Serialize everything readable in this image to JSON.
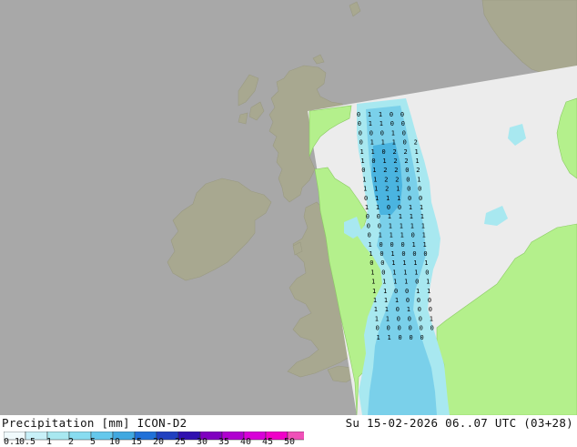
{
  "map": {
    "colors": {
      "sea": "#a8a8a8",
      "land_outside": "#a8a890",
      "domain_bg": "#ececec",
      "domain_land": "#b4f08c",
      "precip_light": "#a8e8f0",
      "precip_mid": "#7ad0ea",
      "precip_heavy": "#4ab4e0"
    },
    "precip_labels": [
      "0",
      "1",
      "1",
      "0",
      "0",
      "0",
      "1",
      "1",
      "0",
      "0",
      "0",
      "0",
      "0",
      "1",
      "0",
      "0",
      "1",
      "1",
      "1",
      "0",
      "2",
      "1",
      "1",
      "0",
      "2",
      "2",
      "1",
      "1",
      "0",
      "1",
      "2",
      "2",
      "1",
      "0",
      "1",
      "2",
      "2",
      "0",
      "2",
      "1",
      "1",
      "2",
      "2",
      "0",
      "1",
      "1",
      "1",
      "2",
      "1",
      "0",
      "0",
      "0",
      "1",
      "1",
      "1",
      "0",
      "0",
      "1",
      "1",
      "0",
      "0",
      "1",
      "1",
      "0",
      "0",
      "1",
      "1",
      "1",
      "1",
      "0",
      "0",
      "1",
      "1",
      "1",
      "1",
      "0",
      "1",
      "1",
      "1",
      "0",
      "1",
      "1",
      "0",
      "0",
      "0",
      "1",
      "1",
      "1",
      "0",
      "1",
      "0",
      "0",
      "0",
      "0",
      "0",
      "1",
      "1",
      "1",
      "1",
      "1",
      "0",
      "1",
      "1",
      "1",
      "0",
      "1",
      "1",
      "1",
      "1",
      "0",
      "1",
      "1",
      "1",
      "0",
      "0",
      "1",
      "1",
      "1",
      "1",
      "1",
      "0",
      "0",
      "0",
      "1",
      "1",
      "0",
      "1",
      "0",
      "0",
      "1",
      "1",
      "0",
      "0",
      "0",
      "1",
      "0",
      "0",
      "0",
      "0",
      "0",
      "0",
      "1",
      "1",
      "0",
      "0",
      "0"
    ]
  },
  "footer": {
    "title_left": "Precipitation [mm]  ICON-D2",
    "title_right": "Su 15-02-2026 06..07 UTC (03+28)"
  },
  "legend": {
    "ticks": [
      "0.1",
      "0.5",
      "1",
      "2",
      "5",
      "10",
      "15",
      "20",
      "25",
      "30",
      "35",
      "40",
      "45",
      "50"
    ],
    "colors": [
      "#f0fafc",
      "#c8f0f8",
      "#a8e8f0",
      "#88dcf0",
      "#64c8ec",
      "#40a8e0",
      "#2070d8",
      "#2040c0",
      "#3010b0",
      "#8000c0",
      "#b000d0",
      "#d800d8",
      "#f000c8",
      "#f050b8"
    ]
  }
}
